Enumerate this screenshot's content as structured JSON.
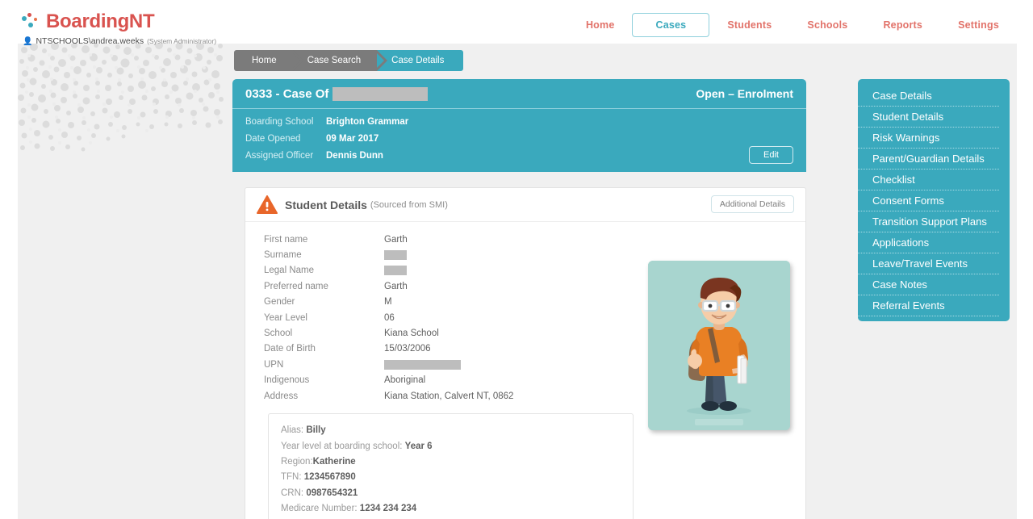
{
  "brand": {
    "name": "BoardingNT"
  },
  "user": {
    "account": "NTSCHOOLS\\andrea.weeks",
    "role": "(System Administrator)",
    "icon": "user-icon"
  },
  "nav": {
    "items": [
      {
        "label": "Home",
        "active": false
      },
      {
        "label": "Cases",
        "active": true
      },
      {
        "label": "Students",
        "active": false
      },
      {
        "label": "Schools",
        "active": false
      },
      {
        "label": "Reports",
        "active": false
      },
      {
        "label": "Settings",
        "active": false
      }
    ]
  },
  "breadcrumb": {
    "items": [
      "Home",
      "Case Search",
      "Case Details"
    ],
    "active": "Case Details"
  },
  "case_header": {
    "title": "0333 - Case Of",
    "name_redacted": true,
    "status": "Open – Enrolment",
    "edit_label": "Edit",
    "fields": [
      {
        "label": "Boarding School",
        "value": "Brighton Grammar"
      },
      {
        "label": "Date Opened",
        "value": "09 Mar 2017"
      },
      {
        "label": "Assigned Officer",
        "value": "Dennis Dunn"
      }
    ]
  },
  "student_details": {
    "warning_icon": "warning-triangle-icon",
    "title": "Student Details",
    "subtitle": "(Sourced from SMI)",
    "additional_details_label": "Additional Details",
    "fields": [
      {
        "label": "First name",
        "value": "Garth",
        "redacted": false
      },
      {
        "label": "Surname",
        "value": "",
        "redacted": "small"
      },
      {
        "label": "Legal Name",
        "value": "",
        "redacted": "small"
      },
      {
        "label": "Preferred name",
        "value": "Garth",
        "redacted": false
      },
      {
        "label": "Gender",
        "value": "M",
        "redacted": false
      },
      {
        "label": "Year Level",
        "value": "06",
        "redacted": false
      },
      {
        "label": "School",
        "value": "Kiana School",
        "redacted": false
      },
      {
        "label": "Date of Birth",
        "value": "15/03/2006",
        "redacted": false
      },
      {
        "label": "UPN",
        "value": "",
        "redacted": "medium"
      },
      {
        "label": "Indigenous",
        "value": "Aboriginal",
        "redacted": false
      },
      {
        "label": "Address",
        "value": "Kiana Station, Calvert NT, 0862",
        "redacted": false
      }
    ],
    "photo": {
      "alt": "student-avatar-illustration"
    },
    "extra": [
      {
        "label": "Alias:",
        "value": "Billy"
      },
      {
        "label": "Year level at boarding school:",
        "value": "Year 6"
      },
      {
        "label": "Region:",
        "value": "Katherine"
      },
      {
        "label": "TFN:",
        "value": "1234567890"
      },
      {
        "label": "CRN:",
        "value": "0987654321"
      },
      {
        "label": "Medicare Number:",
        "value": "1234 234 234"
      }
    ]
  },
  "right_menu": {
    "items": [
      "Case Details",
      "Student Details",
      "Risk Warnings",
      "Parent/Guardian Details",
      "Checklist",
      "Consent Forms",
      "Transition Support Plans",
      "Applications",
      "Leave/Travel Events",
      "Case Notes",
      "Referral Events"
    ]
  },
  "colors": {
    "teal": "#3aa9bd",
    "brand_red": "#d9534f",
    "nav_link": "#e2736a",
    "warning_orange": "#e8662a",
    "page_bg": "#f0f0f0",
    "crumb_gray": "#7b7b7b"
  }
}
